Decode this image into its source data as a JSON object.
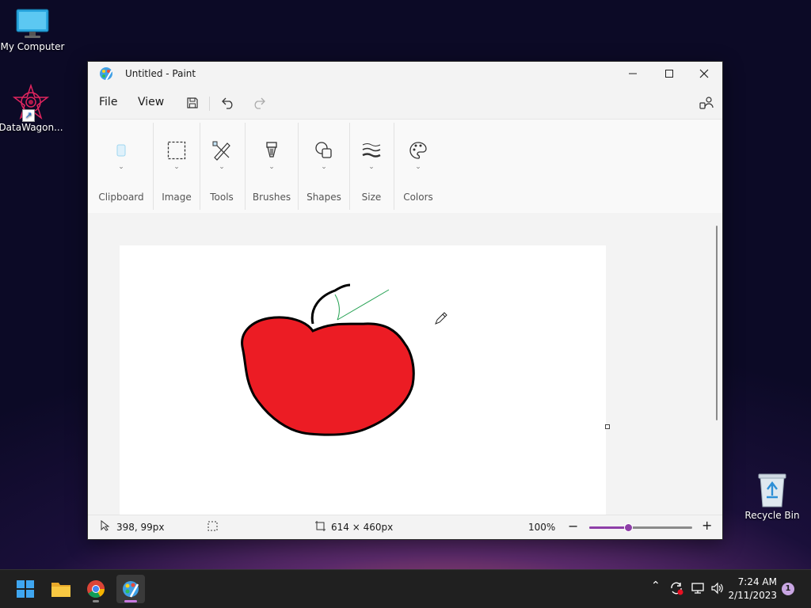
{
  "desktop": {
    "icons": [
      {
        "label": "My Computer",
        "icon": "computer-icon"
      },
      {
        "label": "DataWagon...",
        "icon": "datawagon-shortcut-icon"
      },
      {
        "label": "Recycle Bin",
        "icon": "recycle-bin-icon"
      }
    ]
  },
  "window": {
    "title": "Untitled - Paint",
    "menu": {
      "file": "File",
      "view": "View"
    }
  },
  "ribbon": {
    "groups": [
      {
        "label": "Clipboard",
        "icon": "clipboard-icon"
      },
      {
        "label": "Image",
        "icon": "selection-icon"
      },
      {
        "label": "Tools",
        "icon": "tools-icon"
      },
      {
        "label": "Brushes",
        "icon": "brush-icon"
      },
      {
        "label": "Shapes",
        "icon": "shapes-icon"
      },
      {
        "label": "Size",
        "icon": "size-icon"
      },
      {
        "label": "Colors",
        "icon": "palette-icon"
      }
    ]
  },
  "canvas": {
    "drawing": "red apple with stem and green leaf",
    "fill_color": "#ec1c24",
    "stem_color": "#000000",
    "leaf_color": "#22a050"
  },
  "status": {
    "cursor_position": "398, 99px",
    "canvas_size": "614 × 460px",
    "zoom": "100%",
    "zoom_slider_fraction": 0.38
  },
  "taskbar": {
    "apps": [
      "start-icon",
      "file-explorer-icon",
      "chrome-icon",
      "paint-icon"
    ],
    "time": "7:24 AM",
    "date": "2/11/2023",
    "notifications": "1"
  },
  "colors": {
    "accent": "#8e3fa8",
    "taskbar": "#202020"
  }
}
